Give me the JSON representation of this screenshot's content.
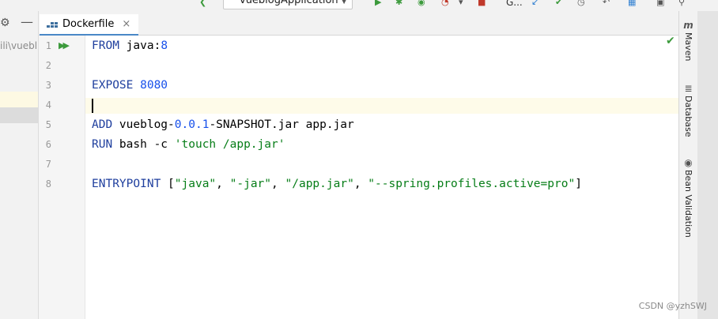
{
  "toolbar": {
    "run_config": "vueblogApplication",
    "extra_label": "G..."
  },
  "project_panel": {
    "path_text": "ili\\vuebl"
  },
  "tabs": [
    {
      "label": "Dockerfile",
      "close": "×"
    }
  ],
  "editor": {
    "line_numbers": [
      "1",
      "2",
      "3",
      "4",
      "5",
      "6",
      "7",
      "8"
    ],
    "lines": [
      {
        "kw": "FROM",
        "rest": " java:",
        "num": "8"
      },
      {},
      {
        "kw": "EXPOSE",
        "num": " 8080"
      },
      {},
      {
        "kw": "ADD",
        "rest": " vueblog-",
        "num": "0.0.1",
        "rest2": "-SNAPSHOT.jar app.jar"
      },
      {
        "kw": "RUN",
        "rest": " bash -c ",
        "str": "'touch /app.jar'"
      },
      {},
      {
        "kw": "ENTRYPOINT",
        "rest": " [",
        "s1": "\"java\"",
        "c1": ", ",
        "s2": "\"-jar\"",
        "c2": ", ",
        "s3": "\"/app.jar\"",
        "c3": ", ",
        "s4": "\"--spring.profiles.active=pro\"",
        "end": "]"
      }
    ]
  },
  "right_tools": [
    {
      "label": "Maven",
      "icon": "maven-icon"
    },
    {
      "label": "Database",
      "icon": "database-icon"
    },
    {
      "label": "Bean Validation",
      "icon": "bean-validation-icon"
    }
  ],
  "watermark": "CSDN @yzhSWJ",
  "colors": {
    "keyword": "#1f3f9e",
    "number": "#1750eb",
    "string": "#067d17",
    "tab_underline": "#4a88c7",
    "caret_line": "#fefbe9"
  }
}
